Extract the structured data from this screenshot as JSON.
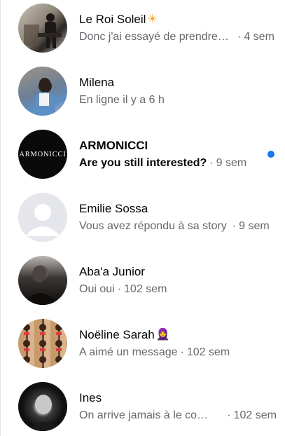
{
  "conversations": [
    {
      "name": "Le Roi Soleil",
      "emoji": "☀",
      "message": "Donc j'ai essayé de prendre un taxi pour venir",
      "time": "4 sem",
      "unread": false,
      "avatar": "photo-man-statue"
    },
    {
      "name": "Milena",
      "emoji": "",
      "message": "En ligne il y a 6 h",
      "time": "",
      "unread": false,
      "avatar": "photo-woman-denim"
    },
    {
      "name": "ARMONICCI",
      "emoji": "",
      "message": "Are you still interested?",
      "time": "9 sem",
      "unread": true,
      "avatar": "armonicci-logo",
      "logo_text": "ARMONICCI"
    },
    {
      "name": "Emilie Sossa",
      "emoji": "",
      "message": "Vous avez répondu à sa story",
      "time": "9 sem",
      "unread": false,
      "avatar": "default-avatar"
    },
    {
      "name": "Aba'a Junior",
      "emoji": "",
      "message": "Oui oui",
      "time": "102 sem",
      "unread": false,
      "avatar": "photo-man-bw"
    },
    {
      "name": "Noëline Sarah",
      "emoji": "🧕",
      "message": "A aimé un message",
      "time": "102 sem",
      "unread": false,
      "avatar": "photo-collage"
    },
    {
      "name": "Ines",
      "emoji": "",
      "message": "On arrive jamais à le comprendre",
      "time": "102 sem",
      "unread": false,
      "avatar": "photo-woman-bw"
    }
  ],
  "separator": "·",
  "colors": {
    "unread_dot": "#1877f2",
    "secondary_text": "#65676b",
    "primary_text": "#050505",
    "default_avatar_bg": "#e4e6eb"
  }
}
